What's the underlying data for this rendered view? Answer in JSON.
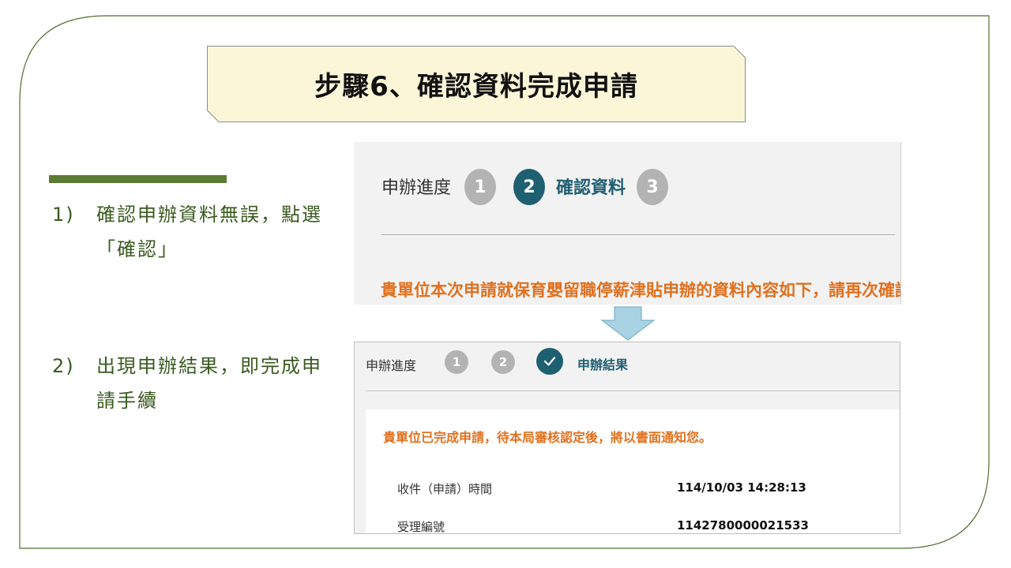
{
  "slide": {
    "title": "步驟6、確認資料完成申請",
    "steps": [
      {
        "num": "1)",
        "text": "確認申辦資料無誤，點選「確認」"
      },
      {
        "num": "2)",
        "text": "出現申辦結果，即完成申請手續"
      }
    ],
    "colors": {
      "accent_green": "#5b7b34",
      "title_bg": "#fbf6d8",
      "step_text": "#3a5a1f"
    }
  },
  "screenshot1": {
    "progress_label": "申辦進度",
    "step1": "1",
    "step2": "2",
    "step2_label": "確認資料",
    "step3": "3",
    "message": "貴單位本次申請就保育嬰留職停薪津貼申辦的資料內容如下，請再次確認。"
  },
  "screenshot2": {
    "progress_label": "申辦進度",
    "step1": "1",
    "step2": "2",
    "step3_icon": "check-icon",
    "step3_label": "申辦結果",
    "message": "貴單位已完成申請，待本局審核認定後，將以書面通知您。",
    "rows": [
      {
        "label": "收件（申請）時間",
        "value": "114/10/03 14:28:13"
      },
      {
        "label": "受理編號",
        "value": "1142780000021533"
      }
    ]
  }
}
